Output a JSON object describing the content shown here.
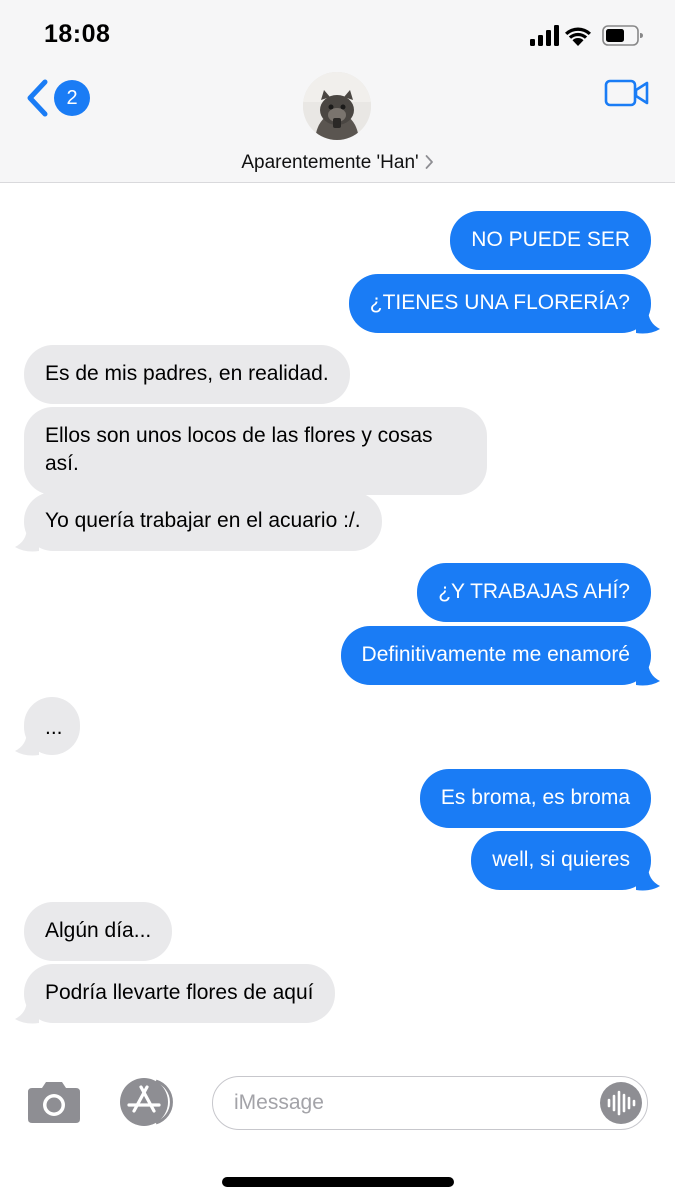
{
  "status_bar": {
    "time": "18:08"
  },
  "header": {
    "back_badge": "2",
    "contact_name": "Aparentemente 'Han'",
    "icons": {
      "back": "chevron-left-icon",
      "video": "video-camera-icon",
      "name_chevron": "chevron-right-icon"
    }
  },
  "messages": [
    {
      "sender": "me",
      "text": "NO PUEDE SER"
    },
    {
      "sender": "me",
      "text": "¿TIENES UNA FLORERÍA?"
    },
    {
      "sender": "them",
      "text": "Es de mis padres, en realidad."
    },
    {
      "sender": "them",
      "text": "Ellos son unos locos de las flores y cosas así."
    },
    {
      "sender": "them",
      "text": "Yo quería trabajar en el acuario :/."
    },
    {
      "sender": "me",
      "text": "¿Y TRABAJAS AHÍ?"
    },
    {
      "sender": "me",
      "text": "Definitivamente me enamoré"
    },
    {
      "sender": "them",
      "text": "..."
    },
    {
      "sender": "me",
      "text": "Es broma, es broma"
    },
    {
      "sender": "me",
      "text": "well, si quieres"
    },
    {
      "sender": "them",
      "text": "Algún día..."
    },
    {
      "sender": "them",
      "text": "Podría llevarte flores de aquí"
    }
  ],
  "input_bar": {
    "placeholder": "iMessage",
    "icons": {
      "camera": "camera-icon",
      "apps": "app-store-icon",
      "audio": "audio-waveform-icon"
    }
  },
  "colors": {
    "accent": "#1a7cf5",
    "incoming_bubble": "#e9e9eb",
    "header_bg": "#f6f6f7"
  }
}
